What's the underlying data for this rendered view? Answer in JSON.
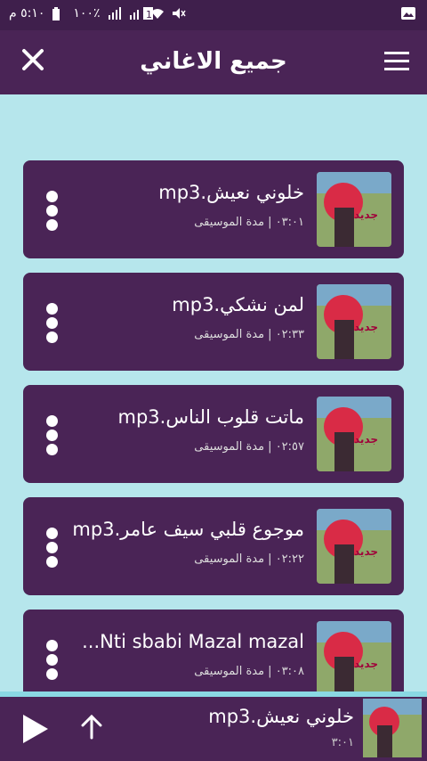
{
  "status_bar": {
    "time": "٥:١٠ م",
    "battery": "١٠٠٪"
  },
  "app_bar": {
    "title": "جميع الاغاني",
    "close_icon": "close-icon",
    "menu_icon": "hamburger-menu-icon"
  },
  "songs": [
    {
      "title": "خلوني نعيش.mp3",
      "meta": "٠٣:٠١ | مدة الموسيقى"
    },
    {
      "title": "لمن نشكي.mp3",
      "meta": "٠٢:٣٣ | مدة الموسيقى"
    },
    {
      "title": "ماتت قلوب الناس.mp3",
      "meta": "٠٢:٥٧ | مدة الموسيقى"
    },
    {
      "title": "موجوع قلبي سيف عامر.mp3",
      "meta": "٠٢:٢٢ | مدة الموسيقى"
    },
    {
      "title": "Nti sbabi  Mazal mazal...",
      "meta": "٠٣:٠٨ | مدة الموسيقى"
    }
  ],
  "player": {
    "title": "خلوني نعيش.mp3",
    "time": "٣:٠١"
  },
  "colors": {
    "primary": "#4a2456",
    "statusbar": "#3f1f4c",
    "background": "#b6e6ec"
  }
}
